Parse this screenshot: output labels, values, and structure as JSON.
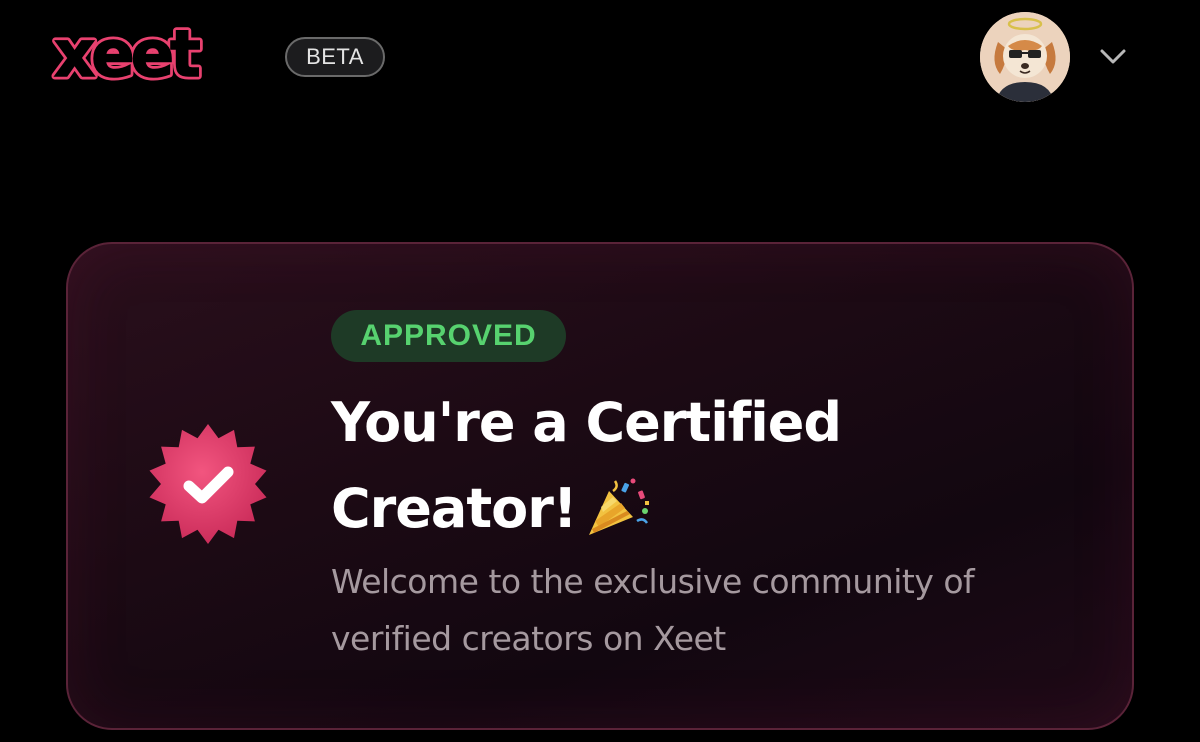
{
  "header": {
    "logo_text": "xeet",
    "beta_label": "BETA",
    "avatar_icon": "avatar-dog-halo-icon",
    "menu_icon": "chevron-down-icon"
  },
  "card": {
    "status_label": "APPROVED",
    "title_line1": "You're a Certified",
    "title_line2": "Creator!",
    "title_emoji_icon": "party-popper-icon",
    "subtitle": "Welcome to the exclusive community of verified creators on Xeet",
    "badge_icon": "verified-badge-icon"
  },
  "colors": {
    "background": "#000000",
    "brand_pink": "#e8416f",
    "badge_pink": "#e23d6b",
    "approved_green": "#57d26f",
    "approved_bg": "#1e3a26",
    "card_border": "#5a2338"
  }
}
